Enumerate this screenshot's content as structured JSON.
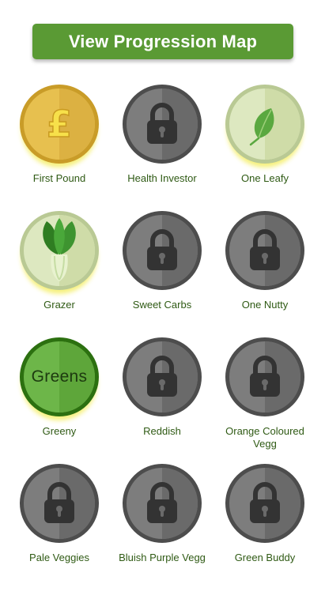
{
  "header": {
    "map_button_label": "View Progression Map"
  },
  "badges": [
    {
      "label": "First Pound",
      "state": "unlocked",
      "icon": "pound-icon"
    },
    {
      "label": "Health Investor",
      "state": "locked",
      "icon": "lock-icon"
    },
    {
      "label": "One Leafy",
      "state": "unlocked",
      "icon": "leaf-icon"
    },
    {
      "label": "Grazer",
      "state": "unlocked",
      "icon": "bok-choy-icon"
    },
    {
      "label": "Sweet Carbs",
      "state": "locked",
      "icon": "lock-icon"
    },
    {
      "label": "One Nutty",
      "state": "locked",
      "icon": "lock-icon"
    },
    {
      "label": "Greeny",
      "state": "unlocked",
      "icon": "greens-text-icon",
      "icon_text": "Greens"
    },
    {
      "label": "Reddish",
      "state": "locked",
      "icon": "lock-icon"
    },
    {
      "label": "Orange Coloured Vegg",
      "state": "locked",
      "icon": "lock-icon"
    },
    {
      "label": "Pale Veggies",
      "state": "locked",
      "icon": "lock-icon"
    },
    {
      "label": "Bluish Purple Vegg",
      "state": "locked",
      "icon": "lock-icon"
    },
    {
      "label": "Green Buddy",
      "state": "locked",
      "icon": "lock-icon"
    }
  ],
  "colors": {
    "primary_button": "#5a9a34",
    "label_text": "#2f5a14",
    "locked_disc": "#7d7d7d",
    "locked_rim": "#4d4d4d",
    "gold_disc": "#e7c04f",
    "greens_disc": "#6db649"
  }
}
